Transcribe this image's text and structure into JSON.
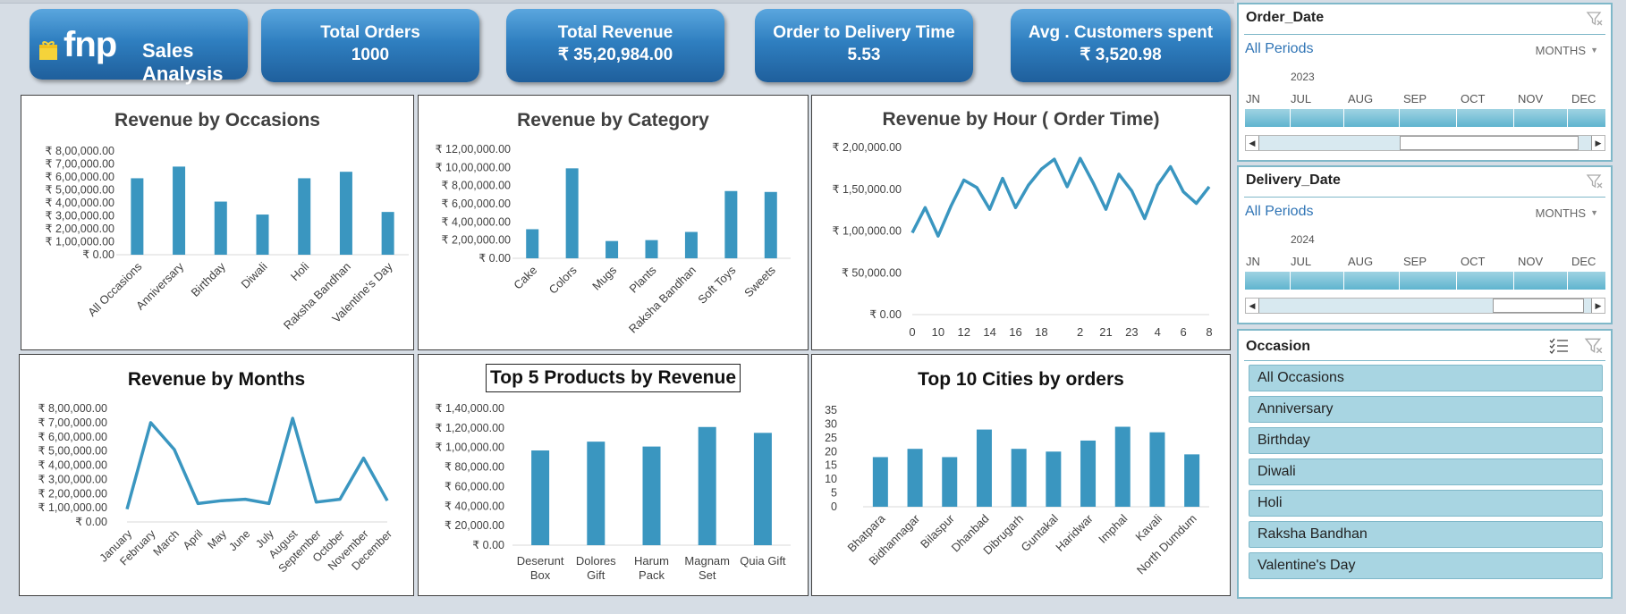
{
  "header": {
    "brand": "fnp",
    "title": "Sales Analysis",
    "kpis": [
      {
        "label": "Total Orders",
        "value": "1000"
      },
      {
        "label": "Total Revenue",
        "value": "₹ 35,20,984.00"
      },
      {
        "label": "Order to Delivery Time",
        "value": "5.53"
      },
      {
        "label": "Avg . Customers spent",
        "value": "₹ 3,520.98"
      }
    ]
  },
  "colors": {
    "series": "#3a96c0",
    "kpi": "#2f7fc0",
    "slicer": "#a8d5e2",
    "slicer_border": "#7fb8c9"
  },
  "chart_data": [
    {
      "id": "occasions",
      "type": "bar",
      "title": "Revenue by Occasions",
      "categories": [
        "All Occasions",
        "Anniversary",
        "Birthday",
        "Diwali",
        "Holi",
        "Raksha Bandhan",
        "Valentine's Day"
      ],
      "values": [
        590000,
        680000,
        410000,
        310000,
        590000,
        640000,
        330000
      ],
      "yticks": [
        "₹ 8,00,000.00",
        "₹ 7,00,000.00",
        "₹ 6,00,000.00",
        "₹ 5,00,000.00",
        "₹ 4,00,000.00",
        "₹ 3,00,000.00",
        "₹ 2,00,000.00",
        "₹ 1,00,000.00",
        "₹ 0.00"
      ],
      "ylim": [
        0,
        800000
      ]
    },
    {
      "id": "category",
      "type": "bar",
      "title": "Revenue by Category",
      "categories": [
        "Cake",
        "Colors",
        "Mugs",
        "Plants",
        "Raksha Bandhan",
        "Soft Toys",
        "Sweets"
      ],
      "values": [
        320000,
        990000,
        190000,
        200000,
        290000,
        740000,
        730000
      ],
      "yticks": [
        "₹ 12,00,000.00",
        "₹ 10,00,000.00",
        "₹ 8,00,000.00",
        "₹ 6,00,000.00",
        "₹ 4,00,000.00",
        "₹ 2,00,000.00",
        "₹ 0.00"
      ],
      "ylim": [
        0,
        1200000
      ]
    },
    {
      "id": "hour",
      "type": "line",
      "title": "Revenue by Hour ( Order Time)",
      "x": [
        0,
        1,
        2,
        3,
        4,
        5,
        6,
        7,
        8,
        9,
        10,
        11,
        12,
        13,
        14,
        15,
        16,
        17,
        18,
        19,
        20,
        21,
        22,
        23
      ],
      "values": [
        98000,
        128000,
        94000,
        130000,
        161000,
        152000,
        126000,
        163000,
        128000,
        155000,
        174000,
        186000,
        153000,
        187000,
        158000,
        126000,
        168000,
        148000,
        115000,
        155000,
        177000,
        147000,
        133000,
        153000
      ],
      "xticks": [
        "0",
        "10",
        "12",
        "14",
        "16",
        "18",
        "2",
        "21",
        "23",
        "4",
        "6",
        "8"
      ],
      "yticks": [
        "₹ 2,00,000.00",
        "₹ 1,50,000.00",
        "₹ 1,00,000.00",
        "₹ 50,000.00",
        "₹ 0.00"
      ],
      "ylim": [
        0,
        200000
      ]
    },
    {
      "id": "months",
      "type": "line",
      "title": "Revenue by Months",
      "categories": [
        "January",
        "February",
        "March",
        "April",
        "May",
        "June",
        "July",
        "August",
        "September",
        "October",
        "November",
        "December"
      ],
      "values": [
        90000,
        700000,
        510000,
        130000,
        150000,
        160000,
        130000,
        730000,
        140000,
        160000,
        450000,
        150000
      ],
      "yticks": [
        "₹ 8,00,000.00",
        "₹ 7,00,000.00",
        "₹ 6,00,000.00",
        "₹ 5,00,000.00",
        "₹ 4,00,000.00",
        "₹ 3,00,000.00",
        "₹ 2,00,000.00",
        "₹ 1,00,000.00",
        "₹ 0.00"
      ],
      "ylim": [
        0,
        800000
      ]
    },
    {
      "id": "products",
      "type": "bar",
      "title": "Top 5 Products by Revenue",
      "categories": [
        "Deserunt Box",
        "Dolores Gift",
        "Harum Pack",
        "Magnam Set",
        "Quia Gift"
      ],
      "category_lines": [
        [
          "Deserunt",
          "Box"
        ],
        [
          "Dolores",
          "Gift"
        ],
        [
          "Harum",
          "Pack"
        ],
        [
          "Magnam",
          "Set"
        ],
        [
          "Quia Gift"
        ]
      ],
      "values": [
        97000,
        106000,
        101000,
        121000,
        115000
      ],
      "yticks": [
        "₹ 1,40,000.00",
        "₹ 1,20,000.00",
        "₹ 1,00,000.00",
        "₹ 80,000.00",
        "₹ 60,000.00",
        "₹ 40,000.00",
        "₹ 20,000.00",
        "₹ 0.00"
      ],
      "ylim": [
        0,
        140000
      ]
    },
    {
      "id": "cities",
      "type": "bar",
      "title": "Top 10 Cities by orders",
      "categories": [
        "Bhatpara",
        "Bidhannagar",
        "Bilaspur",
        "Dhanbad",
        "Dibrugarh",
        "Guntakal",
        "Haridwar",
        "Imphal",
        "Kavali",
        "North Dumdum"
      ],
      "values": [
        18,
        21,
        18,
        28,
        21,
        20,
        24,
        29,
        27,
        19
      ],
      "yticks": [
        "35",
        "30",
        "25",
        "20",
        "15",
        "10",
        "5",
        "0"
      ],
      "ylim": [
        0,
        35
      ]
    }
  ],
  "slicers": {
    "order_date": {
      "title": "Order_Date",
      "all_periods": "All Periods",
      "level": "MONTHS",
      "year": "2023",
      "months": [
        "JN",
        "JUL",
        "AUG",
        "SEP",
        "OCT",
        "NOV",
        "DEC"
      ]
    },
    "delivery_date": {
      "title": "Delivery_Date",
      "all_periods": "All Periods",
      "level": "MONTHS",
      "year": "2024",
      "months": [
        "JN",
        "JUL",
        "AUG",
        "SEP",
        "OCT",
        "NOV",
        "DEC"
      ]
    },
    "occasion": {
      "title": "Occasion",
      "items": [
        "All Occasions",
        "Anniversary",
        "Birthday",
        "Diwali",
        "Holi",
        "Raksha Bandhan",
        "Valentine's Day"
      ]
    }
  }
}
